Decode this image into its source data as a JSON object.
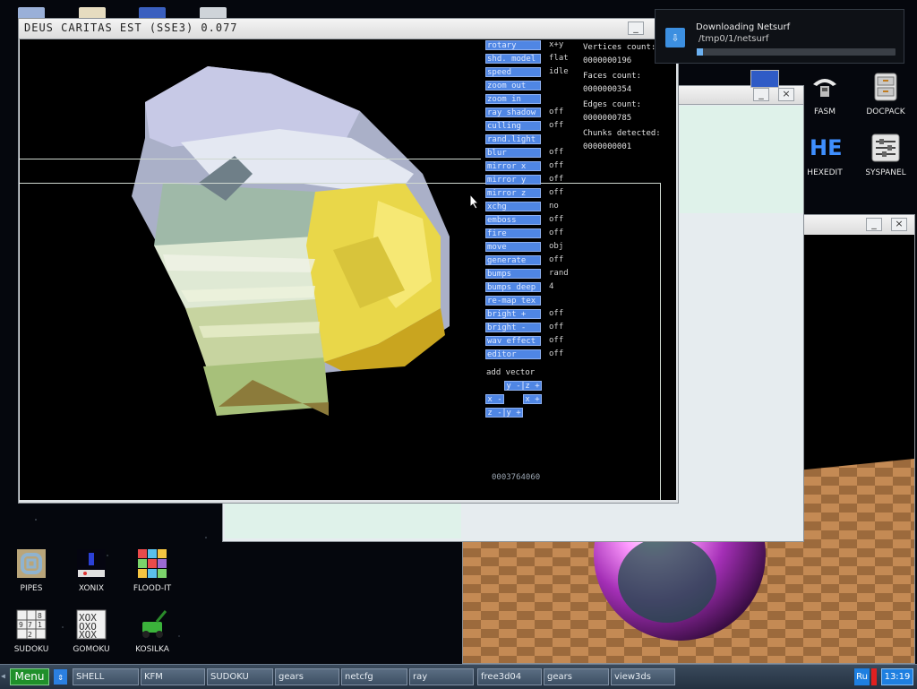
{
  "desktop_icons": [
    {
      "id": "fasm",
      "label": "FASM"
    },
    {
      "id": "docpack",
      "label": "DOCPACK"
    },
    {
      "id": "hexedit",
      "label": "HEXEDIT",
      "glyph": "HE"
    },
    {
      "id": "syspanel",
      "label": "SYSPANEL"
    },
    {
      "id": "pipes",
      "label": "PIPES"
    },
    {
      "id": "xonix",
      "label": "XONIX"
    },
    {
      "id": "floodit",
      "label": "FLOOD-IT"
    },
    {
      "id": "sudoku",
      "label": "SUDOKU"
    },
    {
      "id": "gomoku",
      "label": "GOMOKU"
    },
    {
      "id": "kosilka",
      "label": "KOSILKA"
    }
  ],
  "main_window": {
    "title": "DEUS CARITAS EST (SSE3) 0.077",
    "minimize": "_",
    "menu": [
      {
        "label": "rotary",
        "value": "x+y"
      },
      {
        "label": "shd. model",
        "value": "flat"
      },
      {
        "label": "speed",
        "value": "idle"
      },
      {
        "label": "zoom out",
        "value": ""
      },
      {
        "label": "zoom in",
        "value": ""
      },
      {
        "label": "ray shadow",
        "value": "off"
      },
      {
        "label": "culling",
        "value": "off"
      },
      {
        "label": "rand.light",
        "value": ""
      },
      {
        "label": "blur",
        "value": "off"
      },
      {
        "label": "mirror x",
        "value": "off"
      },
      {
        "label": "mirror y",
        "value": "off"
      },
      {
        "label": "mirror z",
        "value": "off"
      },
      {
        "label": "xchg",
        "value": "no"
      },
      {
        "label": "emboss",
        "value": "off"
      },
      {
        "label": "fire",
        "value": "off"
      },
      {
        "label": "move",
        "value": "obj"
      },
      {
        "label": "generate",
        "value": "off"
      },
      {
        "label": "bumps",
        "value": "rand"
      },
      {
        "label": "bumps deep",
        "value": "4"
      },
      {
        "label": "re-map tex",
        "value": ""
      },
      {
        "label": "bright +",
        "value": "off"
      },
      {
        "label": "bright -",
        "value": "off"
      },
      {
        "label": "wav effect",
        "value": "off"
      },
      {
        "label": "editor",
        "value": "off"
      }
    ],
    "stats": [
      {
        "label": "Vertices count:",
        "value": "0000000196"
      },
      {
        "label": "Faces count:",
        "value": "0000000354"
      },
      {
        "label": "Edges count:",
        "value": "0000000785"
      },
      {
        "label": "Chunks detected:",
        "value": "0000000001"
      }
    ],
    "add_vector": {
      "label": "add vector",
      "buttons": [
        "y -",
        "z +",
        "x -",
        "x +",
        "z -",
        "y +"
      ]
    },
    "counter": "0003764060"
  },
  "notification": {
    "title": "Downloading Netsurf",
    "path": "/tmp0/1/netsurf",
    "progress": 0.03
  },
  "small_window": {
    "minimize": "_",
    "close": "×"
  },
  "ray_window": {
    "minimize": "_",
    "close": "×"
  },
  "taskbar": {
    "menu_label": "Menu",
    "switch_glyph": "⇕",
    "tasks": [
      "SHELL",
      "KFM",
      "SUDOKU",
      "gears",
      "netcfg",
      "ray",
      "free3d04",
      "gears",
      "view3ds"
    ],
    "lang": "Ru",
    "clock": "13:19"
  },
  "colors": {
    "menu_button": "#4f86e4",
    "taskbar": "#2e3c4d",
    "clock_bg": "#1e7fe0",
    "lang_bg": "#1e7fe0"
  }
}
